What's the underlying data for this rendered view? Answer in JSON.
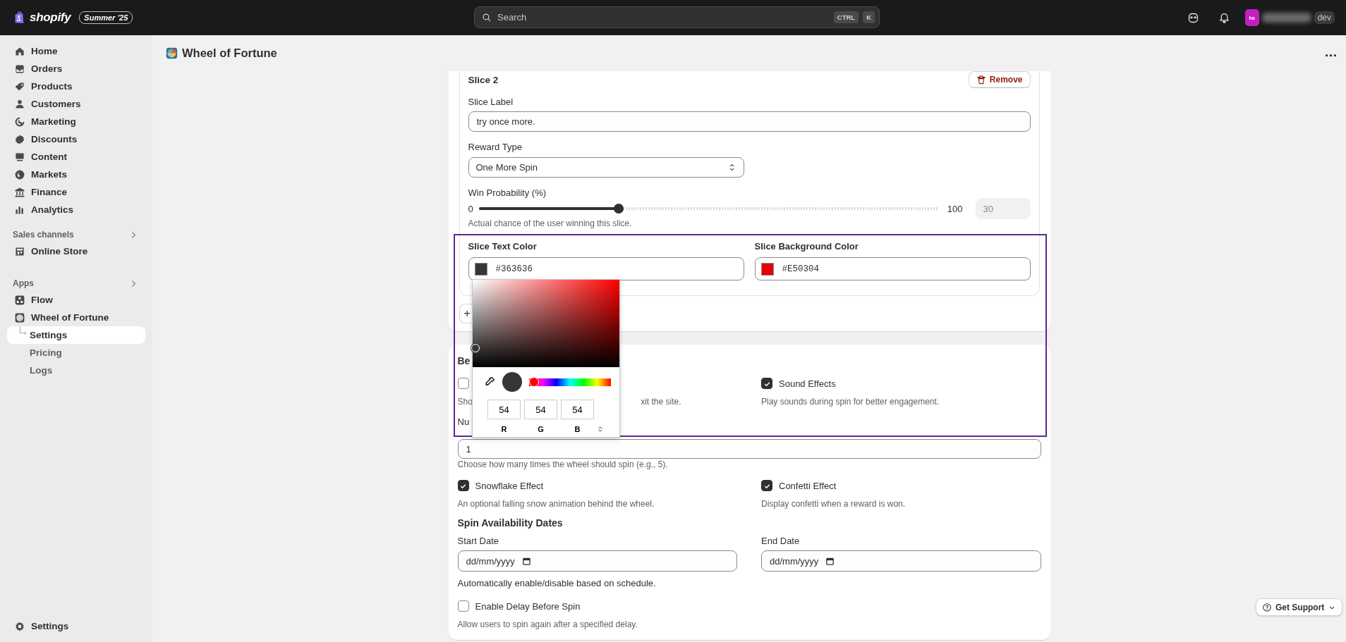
{
  "topbar": {
    "brand": "shopify",
    "badge": "Summer '25",
    "search": {
      "placeholder": "Search"
    },
    "shortcut_keys": [
      "CTRL",
      "K"
    ],
    "account": {
      "initials": "ha",
      "label": "dev"
    }
  },
  "sidebar": {
    "items": [
      {
        "label": "Home",
        "selected": false
      },
      {
        "label": "Orders",
        "selected": false
      },
      {
        "label": "Products",
        "selected": false
      },
      {
        "label": "Customers",
        "selected": false
      },
      {
        "label": "Marketing",
        "selected": false
      },
      {
        "label": "Discounts",
        "selected": false
      },
      {
        "label": "Content",
        "selected": false
      },
      {
        "label": "Markets",
        "selected": false
      },
      {
        "label": "Finance",
        "selected": false
      },
      {
        "label": "Analytics",
        "selected": false
      }
    ],
    "sections": [
      {
        "title": "Sales channels",
        "items": [
          {
            "label": "Online Store",
            "selected": false
          }
        ]
      },
      {
        "title": "Apps",
        "items": [
          {
            "label": "Flow",
            "selected": false
          },
          {
            "label": "Wheel of Fortune",
            "selected": false,
            "children": [
              {
                "label": "Settings",
                "selected": true
              },
              {
                "label": "Pricing",
                "selected": false
              },
              {
                "label": "Logs",
                "selected": false
              }
            ]
          }
        ]
      }
    ],
    "footer": {
      "label": "Settings",
      "selected": false
    }
  },
  "page": {
    "title": "Wheel of Fortune"
  },
  "slice": {
    "title": "Slice 2",
    "remove_label": "Remove",
    "label_field": {
      "label": "Slice Label",
      "value": "try once more."
    },
    "reward_type": {
      "label": "Reward Type",
      "value": "One More Spin"
    },
    "probability": {
      "label": "Win Probability (%)",
      "min": "0",
      "max": "100",
      "level": 0.3,
      "value": "30",
      "help": "Actual chance of the user winning this slice."
    },
    "colors": [
      {
        "label": "Slice Text Color",
        "value": "#363636",
        "color": "#363636"
      },
      {
        "label": "Slice Background Color",
        "value": "#E50304",
        "color": "#e50304"
      }
    ],
    "add_label": "+"
  },
  "behavior": {
    "title": "Be",
    "rows": [
      {
        "kind": "pair",
        "items": [
          {
            "kind": "checkbox",
            "checked": false,
            "help_parts": [
              "Sho",
              "xit the site."
            ]
          },
          {
            "kind": "checkbox",
            "label": "Sound Effects",
            "checked": true,
            "help": "Play sounds during spin for better engagement."
          }
        ]
      },
      {
        "kind": "number",
        "label": "Nu",
        "value": "1",
        "help": "Choose how many times the wheel should spin (e.g., 5)."
      },
      {
        "kind": "pair",
        "items": [
          {
            "kind": "checkbox",
            "label": "Snowflake Effect",
            "checked": true,
            "help": "An optional falling snow animation behind the wheel."
          },
          {
            "kind": "checkbox",
            "label": "Confetti Effect",
            "checked": true,
            "help": "Display confetti when a reward is won."
          }
        ]
      },
      {
        "kind": "heading",
        "text": "Spin Availability Dates"
      },
      {
        "kind": "pair",
        "items": [
          {
            "kind": "date",
            "label": "Start Date",
            "placeholder": "dd/mm/yyyy"
          },
          {
            "kind": "date",
            "label": "End Date",
            "placeholder": "dd/mm/yyyy"
          }
        ]
      },
      {
        "kind": "note",
        "text": "Automatically enable/disable based on schedule."
      },
      {
        "kind": "checkbox",
        "label": "Enable Delay Before Spin",
        "checked": false,
        "help": "Allow users to spin again after a specified delay."
      }
    ]
  },
  "color_picker": {
    "color": "#363636",
    "hue": {
      "level": 0
    },
    "channels": [
      {
        "label": "R",
        "value": "54"
      },
      {
        "label": "G",
        "value": "54"
      },
      {
        "label": "B",
        "value": "54"
      }
    ]
  },
  "support": {
    "label": "Get Support"
  }
}
